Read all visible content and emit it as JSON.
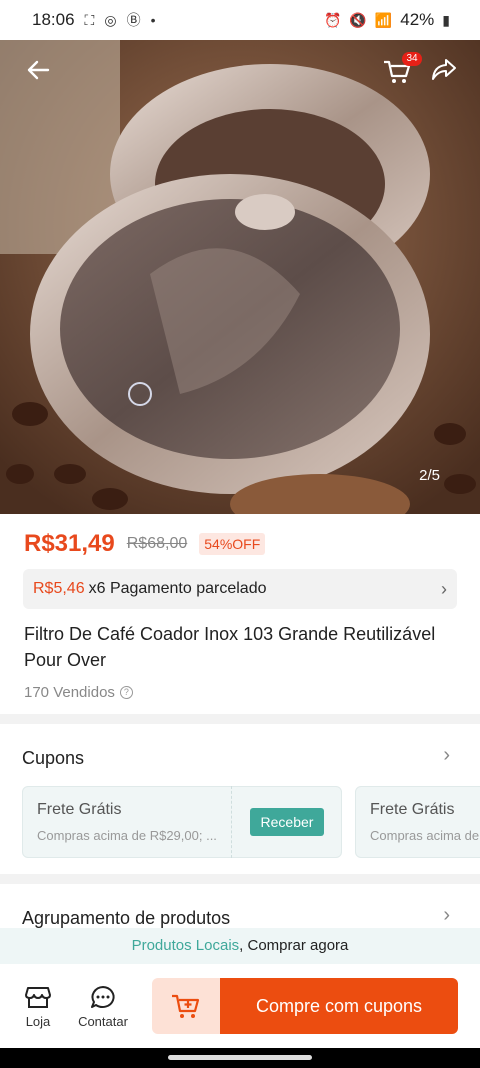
{
  "status_bar": {
    "time": "18:06",
    "battery": "42%"
  },
  "hero": {
    "page_indicator": "2/5",
    "cart_count": "34"
  },
  "product": {
    "price": "R$31,49",
    "old_price": "R$68,00",
    "discount": "54%OFF",
    "installment_price": "R$5,46",
    "installment_text": "x6 Pagamento parcelado",
    "title": "Filtro De Café Coador Inox 103 Grande Reutilizável Pour Over",
    "sold": "170 Vendidos"
  },
  "coupons": {
    "title": "Cupons",
    "items": [
      {
        "title": "Frete Grátis",
        "subtitle": "Compras acima de R$29,00; ..."
      },
      {
        "title": "Frete Grátis",
        "subtitle": "Compras acima de"
      }
    ],
    "receive_label": "Receber"
  },
  "group": {
    "title": "Agrupamento de produtos"
  },
  "banner": {
    "link": "Produtos Locais",
    "text": ", Comprar agora"
  },
  "bottom_bar": {
    "store_label": "Loja",
    "contact_label": "Contatar",
    "buy_label": "Compre com cupons"
  },
  "colors": {
    "accent": "#ec4d10",
    "price": "#e8491d",
    "teal": "#3fa89a"
  }
}
